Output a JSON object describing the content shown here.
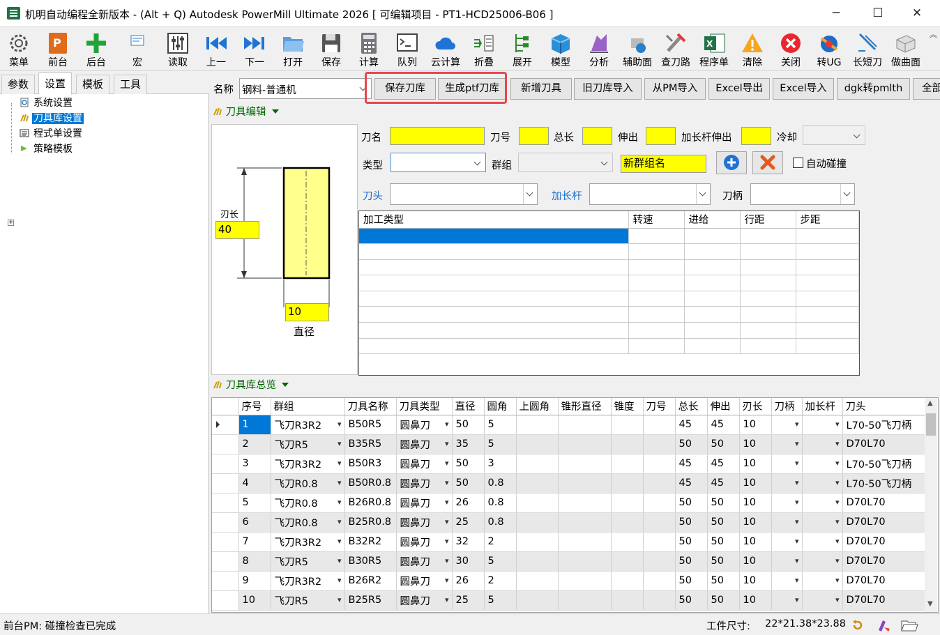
{
  "window": {
    "title": "机明自动编程全新版本 - (Alt + Q) Autodesk PowerMill Ultimate 2026   [ 可编辑项目 - PT1-HCD25006-B06 ]",
    "minimize": "─",
    "maximize": "☐",
    "close": "✕"
  },
  "toolbar": {
    "items": [
      {
        "label": "菜单",
        "icon": "gear-icon"
      },
      {
        "label": "前台",
        "icon": "powermill-icon"
      },
      {
        "label": "后台",
        "icon": "plus-icon"
      },
      {
        "label": "宏",
        "icon": "macro-icon"
      },
      {
        "label": "读取",
        "icon": "sliders-icon"
      },
      {
        "label": "上一",
        "icon": "previous-icon"
      },
      {
        "label": "下一",
        "icon": "next-icon"
      },
      {
        "label": "打开",
        "icon": "folder-icon"
      },
      {
        "label": "保存",
        "icon": "save-icon"
      },
      {
        "label": "计算",
        "icon": "calculator-icon"
      },
      {
        "label": "队列",
        "icon": "terminal-icon"
      },
      {
        "label": "云计算",
        "icon": "cloud-icon"
      },
      {
        "label": "折叠",
        "icon": "collapse-icon"
      },
      {
        "label": "展开",
        "icon": "expand-icon"
      },
      {
        "label": "模型",
        "icon": "cube-icon"
      },
      {
        "label": "分析",
        "icon": "analysis-icon"
      },
      {
        "label": "辅助面",
        "icon": "aux-surface-icon"
      },
      {
        "label": "查刀路",
        "icon": "toolpath-check-icon"
      },
      {
        "label": "程序单",
        "icon": "excel-icon"
      },
      {
        "label": "清除",
        "icon": "warning-icon"
      },
      {
        "label": "关闭",
        "icon": "close-circle-icon"
      },
      {
        "label": "转UG",
        "icon": "ug-icon"
      },
      {
        "label": "长短刀",
        "icon": "tool-length-icon"
      },
      {
        "label": "做曲面",
        "icon": "surface-icon"
      }
    ],
    "more": "︽"
  },
  "left_panel": {
    "tabs": [
      "参数",
      "设置",
      "模板",
      "工具"
    ],
    "active_tab": "设置",
    "tree": [
      "系统设置",
      "刀具库设置",
      "程式单设置",
      "策略模板"
    ],
    "selected": "刀具库设置"
  },
  "name_row": {
    "label": "名称",
    "value": "钢料-普通机",
    "buttons": [
      "保存刀库",
      "生成ptf刀库",
      "新增刀具",
      "旧刀库导入",
      "从PM导入",
      "Excel导出",
      "Excel导入",
      "dgk转pmlth",
      "全部"
    ]
  },
  "tool_editor": {
    "header": "刀具编辑",
    "diagram": {
      "flute_label": "刃长",
      "flute_value": "40",
      "dia_value": "10",
      "dia_label": "直径"
    },
    "fields": {
      "tool_name": "刀名",
      "tool_number": "刀号",
      "overall_length": "总长",
      "stickout": "伸出",
      "extension_stickout": "加长杆伸出",
      "coolant": "冷却",
      "type": "类型",
      "group": "群组",
      "new_group_value": "新群组名",
      "auto_collision": "自动碰撞",
      "tip": "刀头",
      "extension": "加长杆",
      "holder": "刀柄"
    },
    "process_table": {
      "columns": [
        "加工类型",
        "转速",
        "进给",
        "行距",
        "步距"
      ],
      "row_count": 8
    }
  },
  "library": {
    "header": "刀具库总览",
    "columns": [
      "序号",
      "群组",
      "刀具名称",
      "刀具类型",
      "直径",
      "圆角",
      "上圆角",
      "锥形直径",
      "锥度",
      "刀号",
      "总长",
      "伸出",
      "刃长",
      "刀柄",
      "加长杆",
      "刀头"
    ],
    "rows": [
      {
        "seq": "1",
        "group": "飞刀R3R2",
        "name": "B50R5",
        "type": "圆鼻刀",
        "dia": "50",
        "r": "5",
        "total": "45",
        "stick": "45",
        "flute": "10",
        "tip": "L70-50飞刀柄"
      },
      {
        "seq": "2",
        "group": "飞刀R5",
        "name": "B35R5",
        "type": "圆鼻刀",
        "dia": "35",
        "r": "5",
        "total": "50",
        "stick": "50",
        "flute": "10",
        "tip": "D70L70"
      },
      {
        "seq": "3",
        "group": "飞刀R3R2",
        "name": "B50R3",
        "type": "圆鼻刀",
        "dia": "50",
        "r": "3",
        "total": "45",
        "stick": "45",
        "flute": "10",
        "tip": "L70-50飞刀柄"
      },
      {
        "seq": "4",
        "group": "飞刀R0.8",
        "name": "B50R0.8",
        "type": "圆鼻刀",
        "dia": "50",
        "r": "0.8",
        "total": "45",
        "stick": "45",
        "flute": "10",
        "tip": "L70-50飞刀柄"
      },
      {
        "seq": "5",
        "group": "飞刀R0.8",
        "name": "B26R0.8",
        "type": "圆鼻刀",
        "dia": "26",
        "r": "0.8",
        "total": "50",
        "stick": "50",
        "flute": "10",
        "tip": "D70L70"
      },
      {
        "seq": "6",
        "group": "飞刀R0.8",
        "name": "B25R0.8",
        "type": "圆鼻刀",
        "dia": "25",
        "r": "0.8",
        "total": "50",
        "stick": "50",
        "flute": "10",
        "tip": "D70L70"
      },
      {
        "seq": "7",
        "group": "飞刀R3R2",
        "name": "B32R2",
        "type": "圆鼻刀",
        "dia": "32",
        "r": "2",
        "total": "50",
        "stick": "50",
        "flute": "10",
        "tip": "D70L70"
      },
      {
        "seq": "8",
        "group": "飞刀R5",
        "name": "B30R5",
        "type": "圆鼻刀",
        "dia": "30",
        "r": "5",
        "total": "50",
        "stick": "50",
        "flute": "10",
        "tip": "D70L70"
      },
      {
        "seq": "9",
        "group": "飞刀R3R2",
        "name": "B26R2",
        "type": "圆鼻刀",
        "dia": "26",
        "r": "2",
        "total": "50",
        "stick": "50",
        "flute": "10",
        "tip": "D70L70"
      },
      {
        "seq": "10",
        "group": "飞刀R5",
        "name": "B25R5",
        "type": "圆鼻刀",
        "dia": "25",
        "r": "5",
        "total": "50",
        "stick": "50",
        "flute": "10",
        "tip": "D70L70"
      }
    ]
  },
  "status": {
    "left": "前台PM: 碰撞检查已完成",
    "workpiece_label": "工件尺寸:",
    "workpiece_value": "22*21.38*23.88"
  },
  "colors": {
    "accent": "#0078d7",
    "highlight": "#ffff00",
    "section": "#006400",
    "callout": "#e8474c"
  }
}
